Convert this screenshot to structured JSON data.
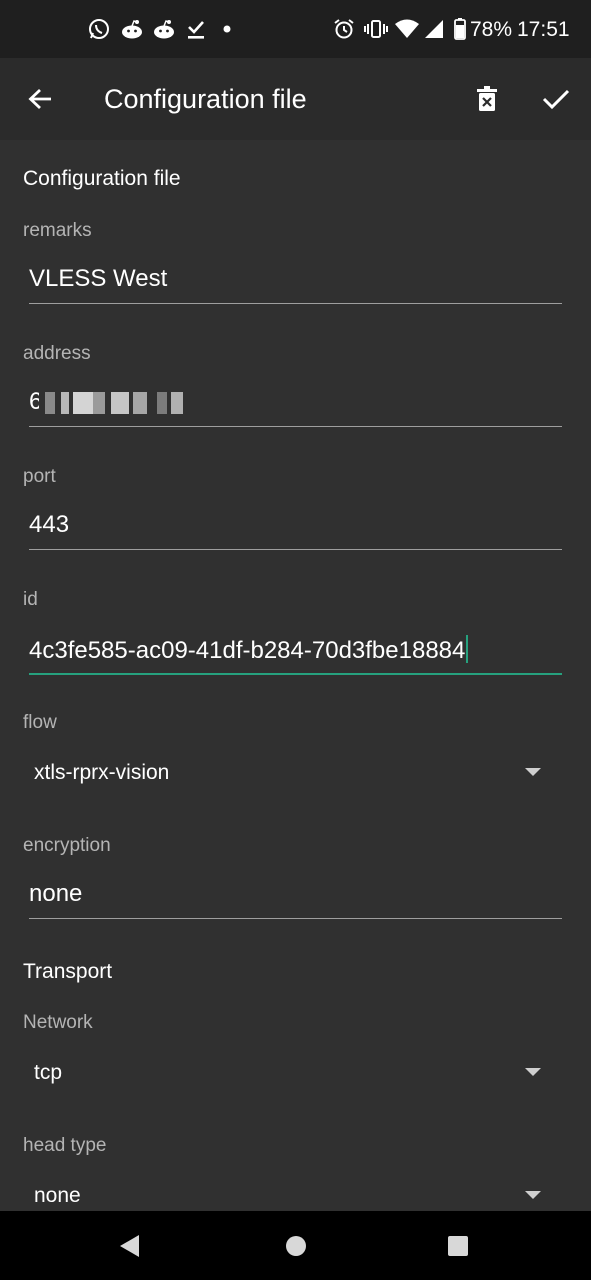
{
  "status_bar": {
    "notification_icons": [
      "whatsapp-icon",
      "reddit-icon",
      "reddit-icon",
      "download-done-icon",
      "dot-icon"
    ],
    "system_icons": [
      "alarm-icon",
      "vibrate-icon",
      "wifi-icon",
      "signal-icon",
      "battery-icon"
    ],
    "battery": "78%",
    "time": "17:51"
  },
  "app_bar": {
    "title": "Configuration file",
    "back_icon": "arrow-back-icon",
    "delete_icon": "delete-icon",
    "save_icon": "check-icon"
  },
  "form": {
    "section_config": "Configuration file",
    "remarks": {
      "label": "remarks",
      "value": "VLESS West"
    },
    "address": {
      "label": "address",
      "value": "6",
      "obscured": true
    },
    "port": {
      "label": "port",
      "value": "443"
    },
    "id": {
      "label": "id",
      "value": "4c3fe585-ac09-41df-b284-70d3fbe18884"
    },
    "flow": {
      "label": "flow",
      "value": "xtls-rprx-vision"
    },
    "encryption": {
      "label": "encryption",
      "value": "none"
    },
    "section_transport": "Transport",
    "network": {
      "label": "Network",
      "value": "tcp"
    },
    "head_type": {
      "label": "head type",
      "value": "none"
    }
  },
  "colors": {
    "background": "#303030",
    "app_bar": "#2b2b2b",
    "status_bar": "#1f1f1f",
    "accent": "#26a17e",
    "label": "#b4b4b4",
    "underline": "#9e9e9e"
  },
  "nav_bar": [
    "back-icon",
    "home-icon",
    "recents-icon"
  ]
}
